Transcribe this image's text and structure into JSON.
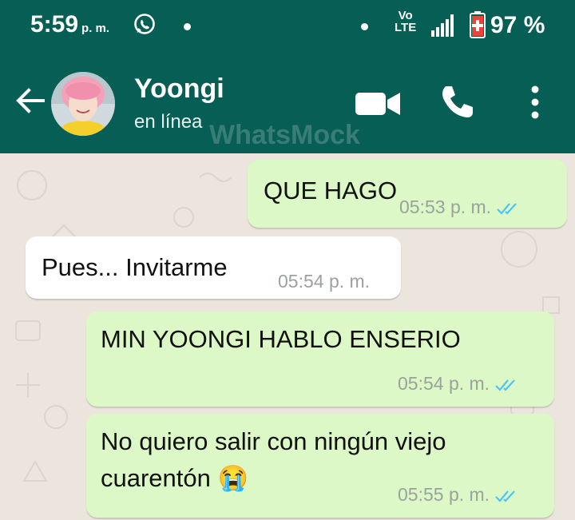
{
  "status_bar": {
    "time": "5:59",
    "ampm": "p. m.",
    "network_top": "Vo",
    "network_bottom": "LTE",
    "battery_percent": "97 %"
  },
  "header": {
    "contact_name": "Yoongi",
    "contact_status": "en línea",
    "watermark": "WhatsMock",
    "icons": [
      "back-arrow-icon",
      "video-call-icon",
      "phone-icon",
      "more-options-icon"
    ]
  },
  "messages": [
    {
      "direction": "outgoing",
      "text": "QUE HAGO",
      "time": "05:53 p. m.",
      "status": "read"
    },
    {
      "direction": "incoming",
      "text": "Pues... Invitarme",
      "time": "05:54 p. m."
    },
    {
      "direction": "outgoing",
      "text": "MIN YOONGI HABLO ENSERIO",
      "time": "05:54 p. m.",
      "status": "read"
    },
    {
      "direction": "outgoing",
      "text_lines": [
        "No quiero salir con ningún viejo",
        "cuarentón 😭"
      ],
      "time": "05:55 p. m.",
      "status": "read"
    }
  ],
  "colors": {
    "header": "#075e54",
    "chat_background": "#ece5dd",
    "outgoing_bubble": "#dcf8c6",
    "incoming_bubble": "#ffffff",
    "read_ticks": "#4fc3f7"
  }
}
